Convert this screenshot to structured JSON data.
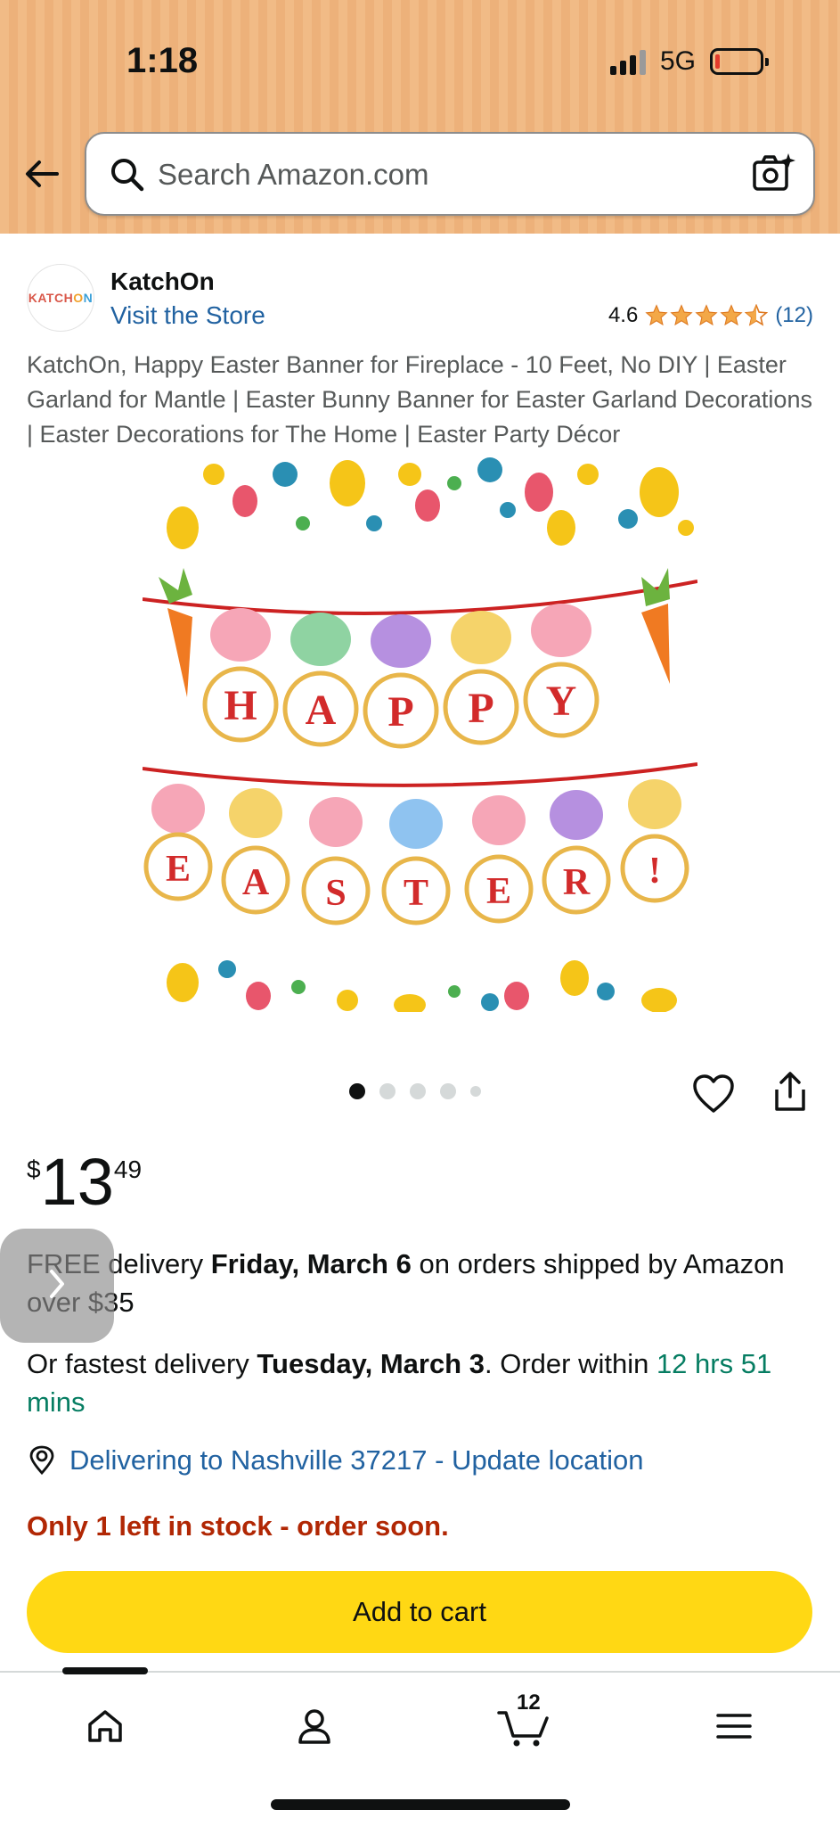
{
  "status_bar": {
    "time": "1:18",
    "network": "5G"
  },
  "search": {
    "placeholder": "Search Amazon.com"
  },
  "seller": {
    "logo_text_a": "KATCH",
    "logo_text_b": "O",
    "logo_text_c": "N",
    "name": "KatchOn",
    "visit_store": "Visit the Store"
  },
  "rating": {
    "value": "4.6",
    "stars": 4.5,
    "count": "(12)"
  },
  "product": {
    "title": "KatchOn, Happy Easter Banner for Fireplace - 10 Feet, No DIY | Easter Garland for Mantle | Easter Bunny Banner for Easter Garland Decorations | Easter Decorations for The Home | Easter Party Décor",
    "banner_row1": [
      "H",
      "A",
      "P",
      "P",
      "Y"
    ],
    "banner_row2": [
      "E",
      "A",
      "S",
      "T",
      "E",
      "R",
      "!"
    ],
    "image_count": 5,
    "active_image": 1
  },
  "price": {
    "symbol": "$",
    "whole": "13",
    "fraction": "49"
  },
  "delivery": {
    "free_prefix": "FREE delivery ",
    "free_date": "Friday, March 6",
    "free_suffix": " on orders shipped by Amazon over $35",
    "fast_prefix": "Or fastest delivery ",
    "fast_date": "Tuesday, March 3",
    "fast_middle": ". Order within ",
    "fast_time": "12 hrs 51 mins"
  },
  "location": {
    "text": "Delivering to Nashville 37217 - Update location"
  },
  "stock": {
    "text": "Only 1 left in stock - order soon."
  },
  "buttons": {
    "add_to_cart": "Add to cart"
  },
  "nav": {
    "cart_count": "12"
  },
  "colors": {
    "header": "#f1bb86",
    "link": "#2162a1",
    "price_alert": "#b12704",
    "add_to_cart": "#ffd814",
    "green": "#067d62"
  }
}
